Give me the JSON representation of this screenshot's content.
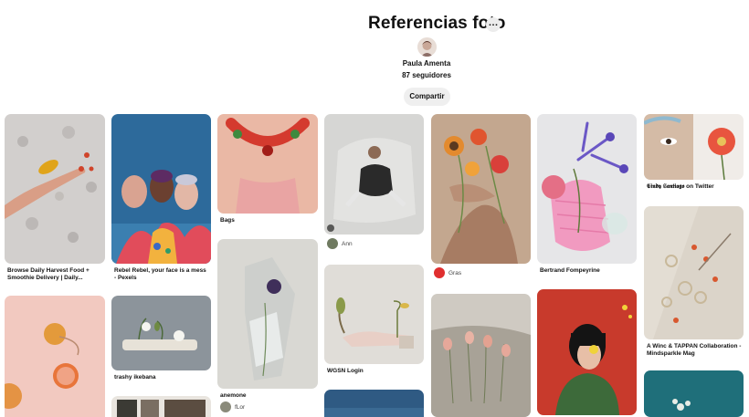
{
  "board": {
    "title": "Referencias foto",
    "more_icon": "…",
    "owner": "Paula Amenta",
    "followers": "87 seguidores",
    "share_label": "Compartir"
  },
  "pins": [
    {
      "title": "Browse Daily Harvest Food + Smoothie Delivery | Daily..."
    },
    {
      "title": "Rebel Rebel, your face is a mess - Pexels"
    },
    {
      "title": "Bags"
    },
    {
      "title": "anemone",
      "author": "fLor"
    },
    {
      "title": "trashy ikebana"
    },
    {
      "author": "Ann"
    },
    {
      "title": "WGSN Login"
    },
    {
      "author": "Gras"
    },
    {
      "title": "Bertrand Fompeyrine"
    },
    {
      "title": "𝕮𝖎𝖓𝖉𝖞 𝕾𝖆𝖓𝖙𝖎𝖆𝖌𝖔 on Twitter"
    },
    {
      "title": "A Winc & TAPPAN Collaboration - Mindsparkle Mag"
    }
  ]
}
